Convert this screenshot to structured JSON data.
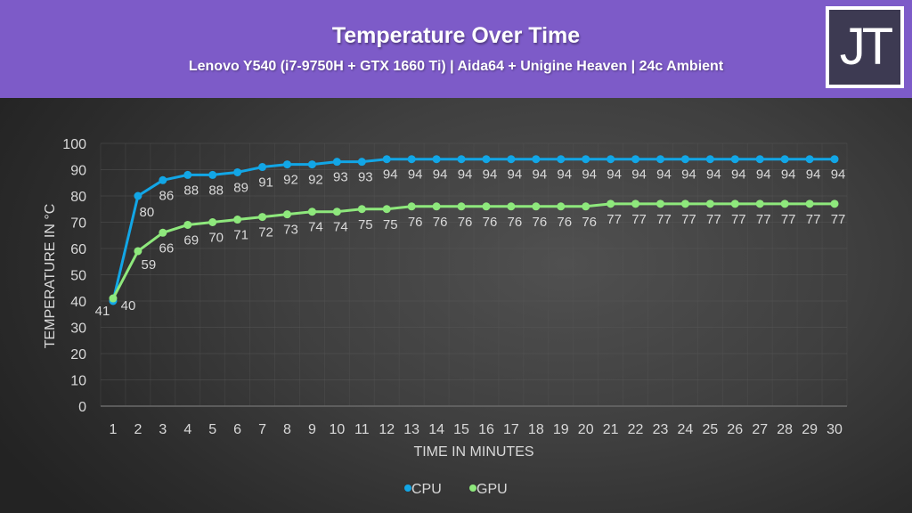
{
  "header": {
    "title": "Temperature Over Time",
    "subtitle": "Lenovo Y540 (i7-9750H + GTX 1660 Ti) | Aida64 + Unigine Heaven | 24c Ambient",
    "logo_text": "JT",
    "background_color": "#7d5bc8"
  },
  "chart_data": {
    "type": "line",
    "title": "Temperature Over Time",
    "subtitle": "Lenovo Y540 (i7-9750H + GTX 1660 Ti) | Aida64 + Unigine Heaven | 24c Ambient",
    "xlabel": "TIME IN MINUTES",
    "ylabel": "TEMPERATURE IN °C",
    "ylim": [
      0,
      100
    ],
    "yticks": [
      0,
      10,
      20,
      30,
      40,
      50,
      60,
      70,
      80,
      90,
      100
    ],
    "grid": true,
    "legend_position": "bottom",
    "categories": [
      "1",
      "2",
      "3",
      "4",
      "5",
      "6",
      "7",
      "8",
      "9",
      "10",
      "11",
      "12",
      "13",
      "14",
      "15",
      "16",
      "17",
      "18",
      "19",
      "20",
      "21",
      "22",
      "23",
      "24",
      "25",
      "26",
      "27",
      "28",
      "29",
      "30"
    ],
    "series": [
      {
        "name": "CPU",
        "color": "#12a6e6",
        "values": [
          40,
          80,
          86,
          88,
          88,
          89,
          91,
          92,
          92,
          93,
          93,
          94,
          94,
          94,
          94,
          94,
          94,
          94,
          94,
          94,
          94,
          94,
          94,
          94,
          94,
          94,
          94,
          94,
          94,
          94
        ]
      },
      {
        "name": "GPU",
        "color": "#8ee87c",
        "values": [
          41,
          59,
          66,
          69,
          70,
          71,
          72,
          73,
          74,
          74,
          75,
          75,
          76,
          76,
          76,
          76,
          76,
          76,
          76,
          76,
          77,
          77,
          77,
          77,
          77,
          77,
          77,
          77,
          77,
          77
        ]
      }
    ]
  }
}
